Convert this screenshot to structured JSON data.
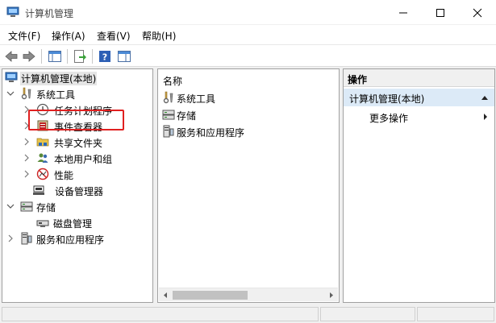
{
  "window": {
    "title": "计算机管理"
  },
  "menu": {
    "file": "文件(F)",
    "action": "操作(A)",
    "view": "查看(V)",
    "help": "帮助(H)"
  },
  "tree": {
    "root": "计算机管理(本地)",
    "system_tools": "系统工具",
    "task_scheduler": "任务计划程序",
    "event_viewer": "事件查看器",
    "shared_folders": "共享文件夹",
    "local_users": "本地用户和组",
    "performance": "性能",
    "device_manager": "设备管理器",
    "storage": "存储",
    "disk_management": "磁盘管理",
    "services_apps": "服务和应用程序"
  },
  "middle": {
    "header": "名称",
    "items": [
      "系统工具",
      "存储",
      "服务和应用程序"
    ]
  },
  "actions": {
    "title": "操作",
    "section": "计算机管理(本地)",
    "more": "更多操作"
  },
  "colors": {
    "highlight": "#dceaf7",
    "callout": "#e02020"
  }
}
